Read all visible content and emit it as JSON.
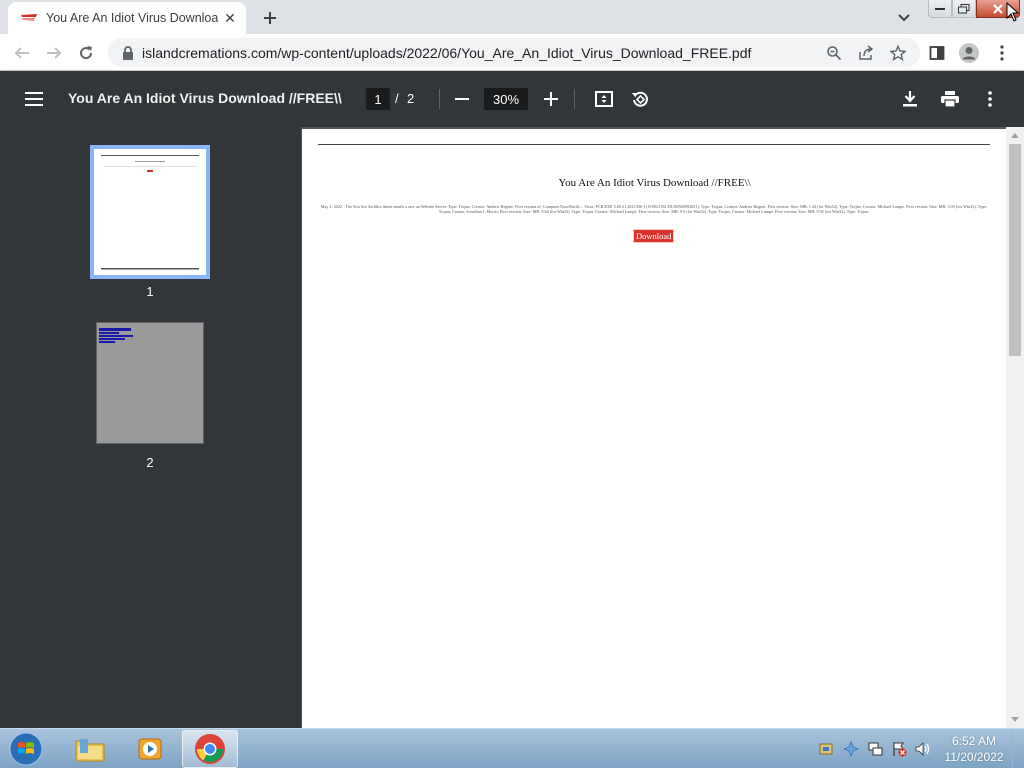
{
  "browser": {
    "tab": {
      "title": "You Are An Idiot Virus Download //FREE\\\\",
      "close_label": "✕"
    },
    "url": "islandcremations.com/wp-content/uploads/2022/06/You_Are_An_Idiot_Virus_Download_FREE.pdf"
  },
  "viewer": {
    "title": "You Are An Idiot Virus Download //FREE\\\\",
    "current_page": "1",
    "separator": "/",
    "total_pages": "2",
    "zoom": "30%"
  },
  "thumbnails": [
    {
      "label": "1"
    },
    {
      "label": "2"
    }
  ],
  "document": {
    "heading": "You Are An Idiot Virus Download //FREE\\\\",
    "body": "May 1, 2022 - The You Are An Idiot threat entails a rare on Website Server. Type: Trojan; Creator: Andrew Regner; First version of: ComputerVirusWorld.... Virus: PCR.EXE 5.69.21.2021306-1 (W0012192-DLN0920092021). Type: Trojan; Creator: Andrew Regner. First version: Size: MB: 1.44 (for Win32). Type: Trojan; Creator: Michael Lampe. First version: Size: MB: 3.03 (for Win32). Type: Trojan; Creator: Jonathan J. Morris. First version: Size: MB: 9.64 (for Win32). Type: Trojan; Creator: Michael Lampe. First version: Size: MB: 9.6 (for Win32). Type: Trojan; Creator: Michael Lampe. First version: Size: MB: 9.92 (for Win32). Type: Trojan.",
    "download_label": "Download"
  },
  "taskbar": {
    "time": "6:52 AM",
    "date": "11/20/2022"
  },
  "colors": {
    "viewer_bar": "#323639",
    "doc_background": "#525659",
    "accent_thumb": "#8ab4f8",
    "download_button": "#d9342b"
  }
}
